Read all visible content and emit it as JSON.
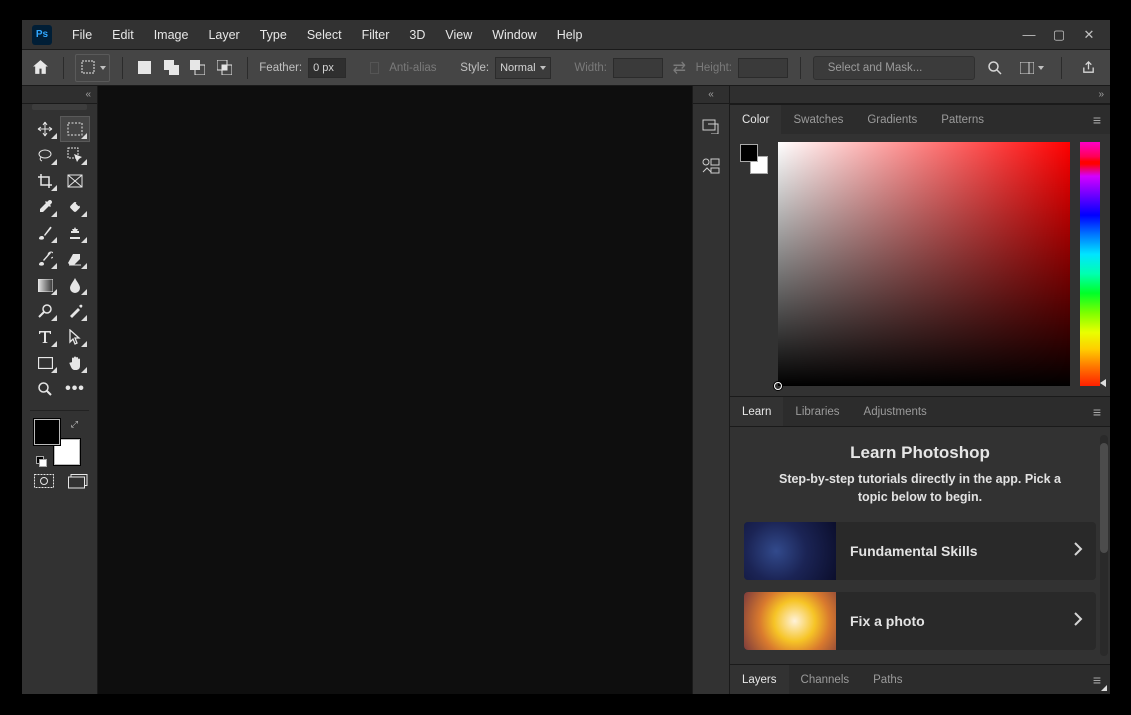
{
  "menu": {
    "items": [
      "File",
      "Edit",
      "Image",
      "Layer",
      "Type",
      "Select",
      "Filter",
      "3D",
      "View",
      "Window",
      "Help"
    ]
  },
  "options_bar": {
    "feather_label": "Feather:",
    "feather_value": "0 px",
    "antialias_label": "Anti-alias",
    "style_label": "Style:",
    "style_value": "Normal",
    "width_label": "Width:",
    "width_value": "",
    "height_label": "Height:",
    "height_value": "",
    "mask_button": "Select and Mask..."
  },
  "color_panel": {
    "tabs": [
      "Color",
      "Swatches",
      "Gradients",
      "Patterns"
    ],
    "active": 0,
    "foreground": "#000000",
    "background": "#ffffff",
    "hue": "#ff0000"
  },
  "learn_panel": {
    "tabs": [
      "Learn",
      "Libraries",
      "Adjustments"
    ],
    "active": 0,
    "title": "Learn Photoshop",
    "subtitle": "Step-by-step tutorials directly in the app. Pick a topic below to begin.",
    "cards": [
      {
        "title": "Fundamental Skills"
      },
      {
        "title": "Fix a photo"
      }
    ]
  },
  "layers_panel": {
    "tabs": [
      "Layers",
      "Channels",
      "Paths"
    ],
    "active": 0
  },
  "tools": [
    "move",
    "rectangular-marquee",
    "lasso",
    "quick-selection",
    "crop",
    "frame",
    "eyedropper",
    "spot-healing",
    "brush",
    "clone-stamp",
    "history-brush",
    "eraser",
    "gradient",
    "blur",
    "dodge",
    "pen",
    "type",
    "path-selection",
    "rectangle",
    "hand",
    "zoom",
    "edit-toolbar"
  ],
  "selected_tool": "rectangular-marquee"
}
